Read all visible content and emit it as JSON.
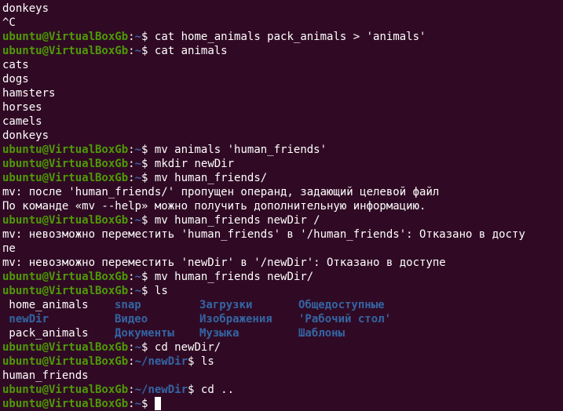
{
  "prompt": {
    "user": "ubuntu@VirtualBoxGb",
    "colon": ":",
    "home": "~",
    "home_newdir": "~/newDir",
    "symbol": "$"
  },
  "lines": {
    "l01": "donkeys",
    "l02": "^C",
    "l03_cmd": " cat home_animals pack_animals > 'animals'",
    "l04_cmd": " cat animals",
    "l05": "cats",
    "l06": "dogs",
    "l07": "hamsters",
    "l08": "horses",
    "l09": "camels",
    "l10": "donkeys",
    "l11_cmd": " mv animals 'human_friends'",
    "l12_cmd": " mkdir newDir",
    "l13_cmd": " mv human_friends/",
    "l14": "mv: после 'human_friends/' пропущен операнд, задающий целевой файл",
    "l15": "По команде «mv --help» можно получить дополнительную информацию.",
    "l16_cmd": " mv human_friends newDir /",
    "l17": "mv: невозможно переместить 'human_friends' в '/human_friends': Отказано в досту",
    "l18": "пе",
    "l19": "mv: невозможно переместить 'newDir' в '/newDir': Отказано в доступе",
    "l20_cmd": " mv human_friends newDir/",
    "l21_cmd": " ls",
    "l25_cmd": " cd newDir/",
    "l26_cmd": " ls",
    "l27": "human_friends",
    "l28_cmd": " cd ..",
    "l29_cmd": " "
  },
  "ls_output": {
    "row1": [
      " home_animals",
      "snap",
      "Загрузки",
      "Общедоступные"
    ],
    "row2": [
      " newDir",
      "Видео",
      "Изображения",
      "'Рабочий стол'"
    ],
    "row3": [
      " pack_animals",
      "Документы",
      "Музыка",
      "Шаблоны"
    ]
  },
  "colors": {
    "background": "#300a24",
    "prompt_user": "#4e9a06",
    "prompt_path": "#3465a4",
    "directory": "#3465a4",
    "text": "#ffffff"
  }
}
